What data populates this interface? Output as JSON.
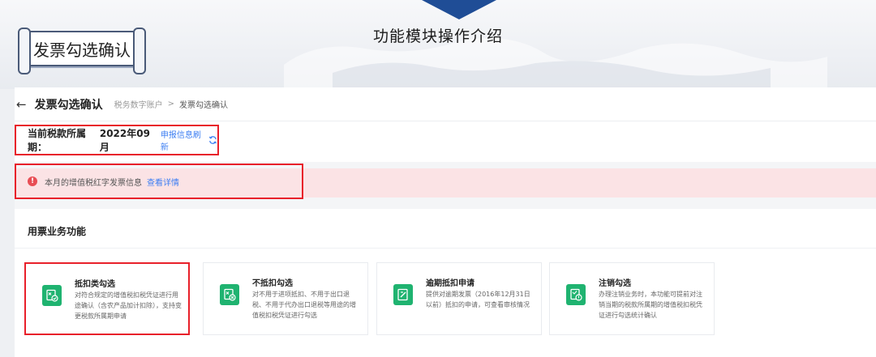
{
  "slide": {
    "module_title": "功能模块操作介绍",
    "page_badge": "发票勾选确认"
  },
  "header": {
    "page_title": "发票勾选确认",
    "breadcrumb": [
      "税务数字账户",
      "发票勾选确认"
    ],
    "breadcrumb_separator": ">"
  },
  "period": {
    "label": "当前税款所属期：",
    "value": "2022年09月",
    "refresh_link": "申报信息刷新"
  },
  "alert": {
    "text": "本月的增值税红字发票信息",
    "link": "查看详情"
  },
  "functions": {
    "title": "用票业务功能",
    "cards": [
      {
        "name": "抵扣类勾选",
        "desc": "对符合规定的增值税扣税凭证进行用途确认（含农产品加计扣除），支持变更税款所属期申请",
        "icon": "deduct-check-icon"
      },
      {
        "name": "不抵扣勾选",
        "desc": "对不用于进项抵扣、不用于出口退税、不用于代办出口退税等用途的增值税扣税凭证进行勾选",
        "icon": "no-deduct-icon"
      },
      {
        "name": "逾期抵扣申请",
        "desc": "提供对逾期发票（2016年12月31日以前）抵扣的申请，可查看审核情况",
        "icon": "overdue-apply-icon"
      },
      {
        "name": "注销勾选",
        "desc": "办理注销业务时，本功能可提前对注销当期的税款所属期的增值税扣税凭证进行勾选统计确认",
        "icon": "cancel-check-icon"
      }
    ]
  },
  "colors": {
    "accent_blue": "#3c7ef2",
    "highlight_red": "#e8202a",
    "icon_green": "#1fb370",
    "alert_bg": "#fbe3e5",
    "banner_triangle": "#1f4d96"
  }
}
